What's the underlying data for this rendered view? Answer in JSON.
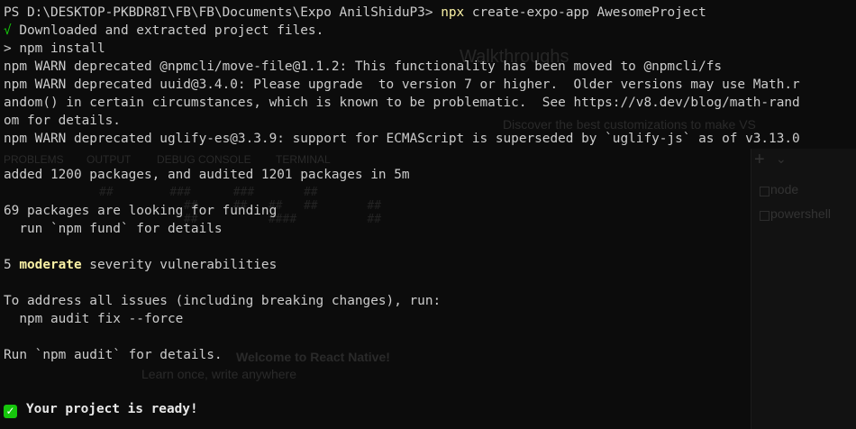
{
  "terminal": {
    "prompt": {
      "path": "PS D:\\DESKTOP-PKBDR8I\\FB\\FB\\Documents\\Expo AnilShiduP3> ",
      "command": "npx",
      "args": " create-expo-app AwesomeProject"
    },
    "downloaded": {
      "mark": "√",
      "text": " Downloaded and extracted project files."
    },
    "npm_install": "> npm install",
    "warn1": "npm WARN deprecated @npmcli/move-file@1.1.2: This functionality has been moved to @npmcli/fs",
    "warn2_l1": "npm WARN deprecated uuid@3.4.0: Please upgrade  to version 7 or higher.  Older versions may use Math.r",
    "warn2_l2": "andom() in certain circumstances, which is known to be problematic.  See https://v8.dev/blog/math-rand",
    "warn2_l3": "om for details.",
    "warn3": "npm WARN deprecated uglify-es@3.3.9: support for ECMAScript is superseded by `uglify-js` as of v3.13.0",
    "added": "added 1200 packages, and audited 1201 packages in 5m",
    "funding": "69 packages are looking for funding",
    "fund_hint": "  run `npm fund` for details",
    "vuln_count": "5 ",
    "vuln_level": "moderate",
    "vuln_rest": " severity vulnerabilities",
    "address": "To address all issues (including breaking changes), run:",
    "audit_fix": "  npm audit fix --force",
    "audit_details": "Run `npm audit` for details.",
    "ready_icon": "✓",
    "ready": "Your project is ready!"
  },
  "background_vscode": {
    "walkthroughs": "Walkthroughs",
    "discover": "Discover the best customizations to make VS",
    "panel_tabs": [
      "PROBLEMS",
      "OUTPUT",
      "DEBUG CONSOLE",
      "TERMINAL"
    ],
    "terminal_items": [
      "node",
      "powershell"
    ],
    "react_native": "Welcome to React Native!",
    "tagline": "Learn once, write anywhere"
  },
  "colors": {
    "background": "#0c0c0c",
    "text": "#cccccc",
    "command_yellow": "#f9f1a5",
    "success_green": "#16c60c"
  }
}
